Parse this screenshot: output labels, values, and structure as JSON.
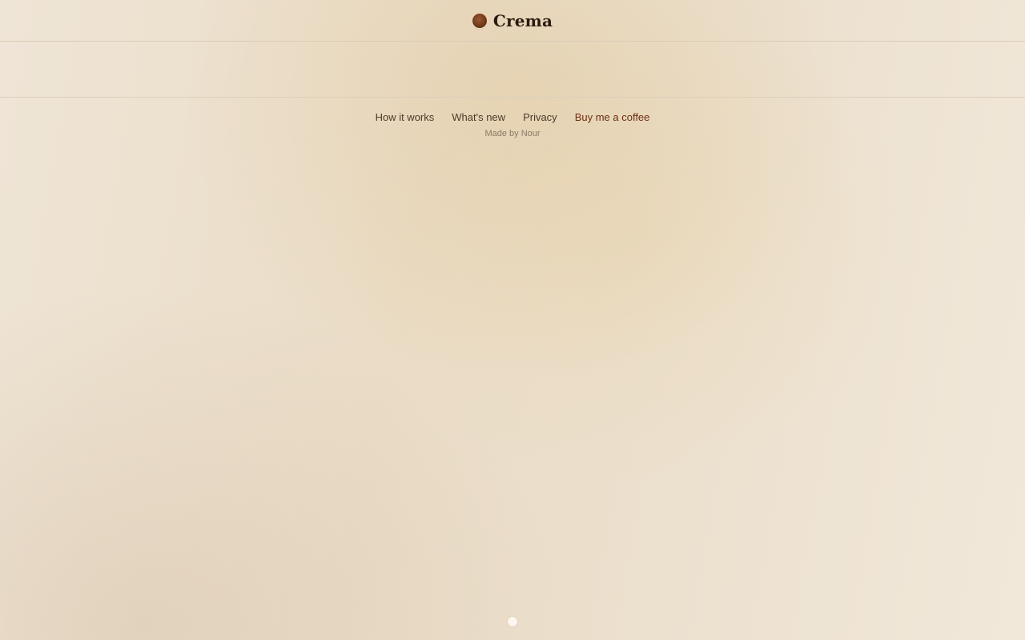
{
  "header": {
    "brand_name": "Crema",
    "logo_icon": "coffee-bean-icon"
  },
  "footer": {
    "links": [
      {
        "label": "How it works"
      },
      {
        "label": "What's new"
      },
      {
        "label": "Privacy"
      },
      {
        "label": "Buy me a coffee"
      }
    ],
    "credit": "Made by Nour"
  },
  "colors": {
    "brand_text": "#2b1a0e",
    "link_text": "#4e3b2b",
    "accent_link": "#6b2f14",
    "muted_text": "#8c7a68"
  }
}
